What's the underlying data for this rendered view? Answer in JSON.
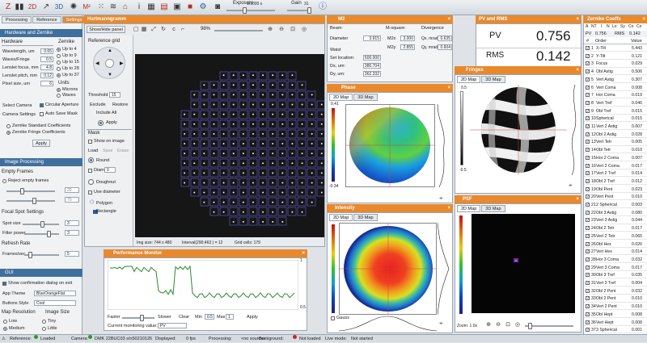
{
  "toolbar": {
    "exposure_label": "Exposure",
    "exposure_value": "1/1000 s",
    "gain_label": "Gain",
    "gain_value": "31"
  },
  "left": {
    "tabs": [
      "Processing",
      "Reference",
      "Settings"
    ],
    "section_hw": "Hardware and Zernike",
    "hardware": "Hardware",
    "zernike": "Zernike",
    "rows": [
      {
        "label": "Wavelength, um",
        "value": "0.65"
      },
      {
        "label": "Waves/Fringe",
        "value": "0.5"
      },
      {
        "label": "Lenslet focus, mm",
        "value": "4.8"
      },
      {
        "label": "Lenslet pitch, mm",
        "value": "0.12"
      },
      {
        "label": "Pixel size, um",
        "value": "6"
      }
    ],
    "zernike_opts": [
      "Up to 4",
      "Up to 9",
      "Up to 15",
      "Up to 28",
      "Up to 37"
    ],
    "units": "Units",
    "unit_opts": [
      "Microns",
      "Waves"
    ],
    "select_camera": "Select Camera",
    "camera_settings": "Camera Settings",
    "circular_aperture": "Circular Aperture",
    "auto_save_mask": "Auto Save Mask",
    "coef_opts": [
      "Zernike Standard Coefficients",
      "Zernike Fringe Coefficients"
    ],
    "apply": "Apply",
    "section_ip": "Image Processing",
    "empty_frames": "Empty Frames",
    "reject_empty": "Reject empty frames",
    "ef_val1": "20",
    "ef_val2": "70",
    "focal_spot": "Focal Spot Settings",
    "spot_size": "Spot size",
    "spot_val": "3",
    "filter_power": "Filter power",
    "filter_val": "3",
    "refresh": "Refresh Rate",
    "frames_sec": "Frames/sec",
    "frames_val": "5",
    "section_gui": "GUI",
    "show_conf": "Show confirmation dialog on exit",
    "app_theme": "App Theme",
    "theme_val": "BlueOrangeFlat",
    "buttons_style": "Buttons Style",
    "buttons_val": "Cool",
    "map_res": "Map Resolution",
    "img_size": "Image Size",
    "res_opts": [
      "Low",
      "Medium"
    ],
    "size_opts": [
      "Tiny",
      "Little"
    ]
  },
  "hart": {
    "title": "Hartmanngramm",
    "show_hide": "Show/Hide panel",
    "zoom": "98%",
    "ref_grid": "Reference grid",
    "threshold": "Threshold",
    "threshold_val": "15",
    "exclude": "Exclude",
    "restore": "Restore",
    "include_all": "Include All",
    "apply": "Apply",
    "mask": "Mask",
    "show_on_image": "Show on image",
    "load": "Load",
    "save": "Save",
    "erase": "Erase",
    "round": "Round",
    "diam": "Diam",
    "diam_val": "0",
    "doughnut": "Doughnut",
    "use_diameter": "Use diameter",
    "polygon": "Polygon",
    "rectangle": "Rectangle",
    "img_size": "Img size: 744 x 480",
    "interval": "Interval(290;463 ) = 12",
    "grid_cells": "Grid cells: 179"
  },
  "m2": {
    "title": "M2",
    "beam": "Beam:",
    "diameter": "Diameter",
    "diameter_val": "3.915",
    "waist": "Waist",
    "set_location": "Set location:",
    "set_val": "600.000",
    "dx": "Dx, um:",
    "dx_val": "380.704",
    "dy": "Dy, um:",
    "dy_val": "362.332",
    "msquare": "M-square:",
    "m2x": "M2x",
    "m2x_val": "3.000",
    "m2y": "M2y",
    "m2y_val": "2.855",
    "divergence": "Divergence",
    "qx": "Qx, mrad",
    "qx_val": "0.635",
    "qy": "Qy, mrad",
    "qy_val": "0.604"
  },
  "pvrms": {
    "title": "PV and RMS",
    "pv_label": "PV",
    "pv_val": "0.756",
    "rms_label": "RMS",
    "rms_val": "0.142"
  },
  "phase": {
    "title": "Phase",
    "tab2d": "2D Map",
    "tab3d": "3D Map",
    "max": "0.41",
    "min": "-0.34"
  },
  "intensity": {
    "title": "Intensity",
    "tab2d": "2D Map",
    "tab3d": "3D Map",
    "gauss": "Gauss"
  },
  "fringes": {
    "title": "Fringes",
    "tab2d": "2D Map",
    "tab3d": "3D Map",
    "max": "0.5",
    "min": "-0.5"
  },
  "psf": {
    "title": "PSF",
    "tab2d": "2D Map",
    "tab3d": "3D Map",
    "zoom": "Zoom: 1.0x"
  },
  "perf": {
    "title": "Performance Monitor",
    "faster": "Faster",
    "slower": "Slower",
    "clear": "Clear",
    "min": "Min",
    "min_val": "0.5",
    "max": "Max",
    "max_val": "1",
    "apply": "Apply",
    "current": "Current monitoring value:",
    "current_val": "PV",
    "y_top": "1",
    "y_bot": "0.5"
  },
  "zernike": {
    "title": "Zernike Coeffs",
    "headers": [
      "A",
      "NT",
      "I",
      "N",
      "Lo",
      "Sy",
      "Co",
      "Co"
    ],
    "pv_label": "PV",
    "pv_val": "0.756",
    "rms_label": "RMS",
    "rms_val": "0.142",
    "col_order": "Order",
    "col_value": "Value",
    "rows": [
      {
        "n": "1",
        "name": "X-Tilt",
        "v": "5.443"
      },
      {
        "n": "2",
        "name": "Y-Tilt",
        "v": "0.121"
      },
      {
        "n": "3",
        "name": "Focus",
        "v": "0.029"
      },
      {
        "n": "4",
        "name": "Obl Astig",
        "v": "0.506"
      },
      {
        "n": "5",
        "name": "Vert Astig",
        "v": "0.307"
      },
      {
        "n": "6",
        "name": "Vert Coma",
        "v": "0.008"
      },
      {
        "n": "7",
        "name": "Hor Coma",
        "v": "0.019"
      },
      {
        "n": "8",
        "name": "Vert Tref",
        "v": "0.046"
      },
      {
        "n": "9",
        "name": "Obl Tref",
        "v": "0.015"
      },
      {
        "n": "10",
        "name": "Spherical",
        "v": "0.015"
      },
      {
        "n": "11",
        "name": "Vert 2 Astig",
        "v": "0.007"
      },
      {
        "n": "12",
        "name": "Obl 2 Astig",
        "v": "0.028"
      },
      {
        "n": "13",
        "name": "Vert Tetr",
        "v": "0.005"
      },
      {
        "n": "14",
        "name": "Obl Tetr",
        "v": "0.010"
      },
      {
        "n": "15",
        "name": "Hor 2 Coma",
        "v": "0.007"
      },
      {
        "n": "16",
        "name": "Vert 2 Coma",
        "v": "0.017"
      },
      {
        "n": "17",
        "name": "Vert 2 Tref",
        "v": "0.014"
      },
      {
        "n": "18",
        "name": "Obl 2 Tref",
        "v": "0.012"
      },
      {
        "n": "19",
        "name": "Obl Pent",
        "v": "0.023"
      },
      {
        "n": "20",
        "name": "Vert Pent",
        "v": "0.010"
      },
      {
        "n": "21",
        "name": "2 Spherical",
        "v": "0.003"
      },
      {
        "n": "22",
        "name": "Obl 3 Astig",
        "v": "0.080"
      },
      {
        "n": "23",
        "name": "Vert 3 Astig",
        "v": "0.044"
      },
      {
        "n": "24",
        "name": "Obl 2 Tetr",
        "v": "0.017"
      },
      {
        "n": "25",
        "name": "Vert 2 Tetr",
        "v": "0.065"
      },
      {
        "n": "26",
        "name": "Obl Hex",
        "v": "0.026"
      },
      {
        "n": "27",
        "name": "Vert Hex",
        "v": "0.014"
      },
      {
        "n": "28",
        "name": "Hor 3 Coma",
        "v": "0.032"
      },
      {
        "n": "29",
        "name": "Vert 3 Coma",
        "v": "0.017"
      },
      {
        "n": "30",
        "name": "Obl 3 Tref",
        "v": "0.035"
      },
      {
        "n": "31",
        "name": "Vert 3 Tref",
        "v": "0.004"
      },
      {
        "n": "32",
        "name": "Obl 2 Pent",
        "v": "0.032"
      },
      {
        "n": "33",
        "name": "Obl 2 Pent",
        "v": "0.010"
      },
      {
        "n": "34",
        "name": "Vert 2 Pent",
        "v": "0.010"
      },
      {
        "n": "35",
        "name": "Obl Hept",
        "v": "0.008"
      },
      {
        "n": "36",
        "name": "Vert Hept",
        "v": "0.008"
      },
      {
        "n": "37",
        "name": "3 Spherical",
        "v": "0.001"
      }
    ]
  },
  "status": {
    "reference": "Reference:",
    "loaded": "Loaded",
    "camera": "Camera:",
    "camera_val": "DMK 22BUC03 s/n50210126",
    "displayed": "Displayed:",
    "displayed_val": "0 fps",
    "processing": "Processing:",
    "processing_val": "<no source>",
    "background": "Background:",
    "not_loaded": "Not loaded",
    "live_mode": "Live mode:",
    "not_started": "Not started"
  }
}
